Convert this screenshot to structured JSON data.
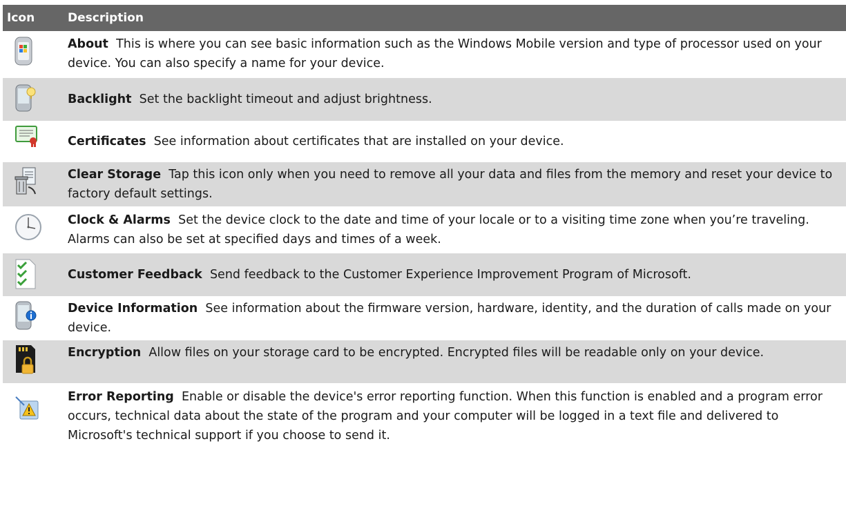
{
  "header": {
    "icon_label": "Icon",
    "description_label": "Description"
  },
  "rows": [
    {
      "title": "About",
      "text": "This is where you can see basic information such as the Windows Mobile version and type of processor used on your device. You can also specify a name for your device.",
      "icon": "windows-device-icon"
    },
    {
      "title": "Backlight",
      "text": "Set the backlight timeout and adjust brightness.",
      "icon": "backlight-device-icon"
    },
    {
      "title": "Certificates",
      "text": "See information about certificates that are installed on your device.",
      "icon": "certificate-icon"
    },
    {
      "title": "Clear Storage",
      "text": "Tap this icon only when you need to remove all your data and files from the memory and reset your device to factory default settings.",
      "icon": "clear-storage-icon"
    },
    {
      "title": "Clock & Alarms",
      "text": "Set the device clock to the date and time of your locale or to a visiting time zone when you’re traveling. Alarms can also be set at specified days and times of a week.",
      "icon": "clock-icon"
    },
    {
      "title": "Customer Feedback",
      "text": "Send feedback to the Customer Experience Improvement Program of Microsoft.",
      "icon": "checklist-icon"
    },
    {
      "title": "Device Information",
      "text": "See information about the firmware version, hardware, identity, and the duration of calls made on your device.",
      "icon": "device-info-icon"
    },
    {
      "title": "Encryption",
      "text": "Allow files on your storage card to be encrypted. Encrypted files will be readable only on your device.",
      "icon": "encryption-lock-icon"
    },
    {
      "title": "Error Reporting",
      "text": "Enable or disable the device's error reporting function. When this function is enabled and a program error occurs, technical data about the state of the program and your computer will be logged in a text file and delivered to Microsoft's technical support if you choose to send it.",
      "icon": "error-reporting-warning-icon"
    }
  ]
}
